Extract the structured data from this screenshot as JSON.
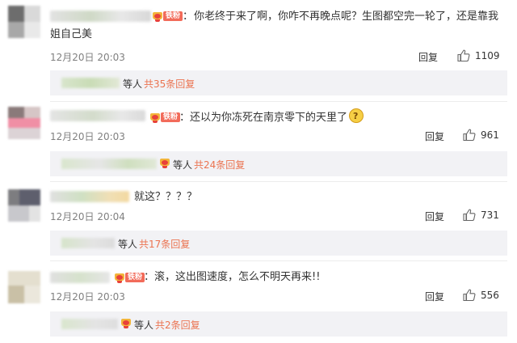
{
  "fan_tag": "铁粉",
  "comments": [
    {
      "text_line1": "你老终于来了啊，你咋不再晚点呢？生图都空完一轮了，还是靠我",
      "text_line2": "姐自己美",
      "time": "12月20日 20:03",
      "reply_label": "回复",
      "likes": "1109",
      "sub_suffix": "等人",
      "sub_link": "共35条回复"
    },
    {
      "text_line1": "：还以为你冻死在南京零下的天里了",
      "time": "12月20日 20:03",
      "reply_label": "回复",
      "likes": "961",
      "sub_suffix": "等人",
      "sub_link": "共24条回复"
    },
    {
      "text_line1": "就这？？？？",
      "time": "12月20日 20:04",
      "reply_label": "回复",
      "likes": "731",
      "sub_suffix": "等人",
      "sub_link": "共17条回复"
    },
    {
      "text_line1": "：滚，这出图速度，怎么不明天再来!!",
      "time": "12月20日 20:03",
      "reply_label": "回复",
      "likes": "556",
      "sub_suffix": "等人",
      "sub_link": "共2条回复"
    }
  ]
}
